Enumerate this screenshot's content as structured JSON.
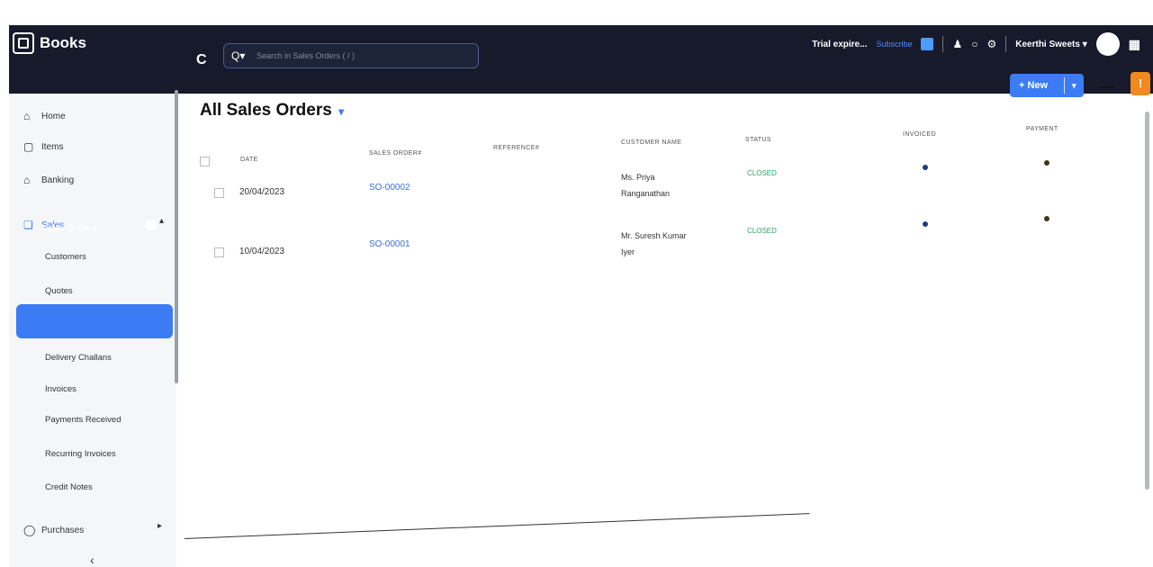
{
  "app": {
    "name": "Books"
  },
  "topbar": {
    "search_placeholder": "Search in Sales Orders ( / )",
    "trial_text": "Trial expire...",
    "subscribe_label": "Subscribe",
    "org_name": "Keerthi Sweets",
    "org_caret": "▾",
    "apps_icon": "▦"
  },
  "sidebar": {
    "items": [
      {
        "label": "Home",
        "icon": "home-icon"
      },
      {
        "label": "Items",
        "icon": "items-icon"
      },
      {
        "label": "Banking",
        "icon": "bank-icon"
      },
      {
        "label": "Sales",
        "icon": "cart-icon"
      }
    ],
    "sales_sub": [
      "Customers",
      "Quotes",
      "Sales Orders",
      "Delivery Challans",
      "Invoices",
      "Payments Received",
      "Recurring Invoices",
      "Credit Notes"
    ],
    "active": "Sales Orders",
    "purchases_label": "Purchases",
    "collapse_icon": "‹"
  },
  "main": {
    "title": "All Sales Orders",
    "new_label": "+ New",
    "more_label": "—",
    "alert_label": "!"
  },
  "table": {
    "headers": {
      "date": "DATE",
      "sales_order": "SALES ORDER#",
      "reference": "REFERENCE#",
      "customer": "CUSTOMER NAME",
      "status": "STATUS",
      "invoiced": "INVOICED",
      "payment": "PAYMENT"
    },
    "rows": [
      {
        "date": "20/04/2023",
        "sales_order": "SO-00002",
        "customer_line1": "Ms. Priya",
        "customer_line2": "Ranganathan",
        "status": "CLOSED"
      },
      {
        "date": "10/04/2023",
        "sales_order": "SO-00001",
        "customer_line1": "Mr. Suresh Kumar",
        "customer_line2": "Iyer",
        "status": "CLOSED"
      }
    ]
  }
}
